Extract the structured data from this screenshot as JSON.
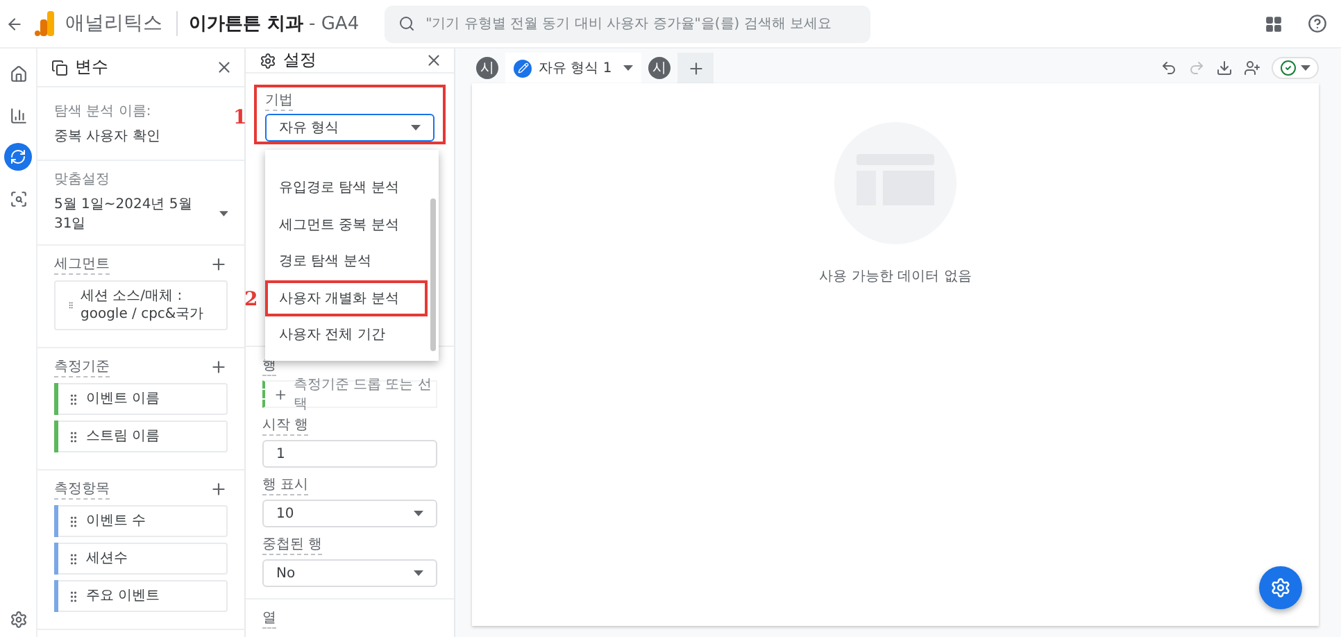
{
  "top_bar": {
    "product": "애널리틱스",
    "property": "이가튼튼 치과",
    "property_suffix": "- GA4",
    "search": {
      "placeholder": "\"기기 유형별 전월 동기 대비 사용자 증가율\"을(를) 검색해 보세요"
    }
  },
  "nav_rail": {
    "items": [
      {
        "kind": "home",
        "selected": false
      },
      {
        "kind": "reports",
        "selected": false
      },
      {
        "kind": "explore",
        "selected": true
      },
      {
        "kind": "advertising",
        "selected": false
      }
    ]
  },
  "variables_panel": {
    "title": "변수",
    "name_label": "탐색 분석 이름:",
    "name": "중복 사용자 확인",
    "date_label": "맞춤설정",
    "date_range": "5월 1일~2024년 5월 31일",
    "sections": [
      {
        "title": "세그먼트",
        "items": [
          {
            "label": "세션 소스/매체 : google / cpc&국가"
          }
        ]
      },
      {
        "title": "측정기준",
        "items": [
          {
            "label": "이벤트 이름",
            "color": "#5cb85c"
          },
          {
            "label": "스트림 이름",
            "color": "#5cb85c"
          }
        ]
      },
      {
        "title": "측정항목",
        "items": [
          {
            "label": "이벤트 수",
            "color": "#7ba7e6"
          },
          {
            "label": "세션수",
            "color": "#7ba7e6"
          },
          {
            "label": "주요 이벤트",
            "color": "#7ba7e6"
          }
        ]
      }
    ]
  },
  "settings_panel": {
    "title": "설정",
    "technique": {
      "label": "기법",
      "value": "자유 형식",
      "annotation": "1"
    },
    "technique_menu": {
      "items": [
        {
          "label": "유입경로 탐색 분석"
        },
        {
          "label": "세그먼트 중복 분석"
        },
        {
          "label": "경로 탐색 분석"
        },
        {
          "label": "사용자 개별화 분석",
          "annotation": "2"
        },
        {
          "label": "사용자 전체 기간"
        }
      ]
    },
    "rows_label": "행",
    "rows_drop": "측정기준 드롭 또는 선택",
    "start_row": {
      "label": "시작 행",
      "value": "1"
    },
    "show_rows": {
      "label": "행 표시",
      "value": "10"
    },
    "nested_rows": {
      "label": "중첩된 행",
      "value": "No"
    },
    "columns_label": "열"
  },
  "tabs": [
    {
      "kind": "avatar",
      "label": "시"
    },
    {
      "kind": "tab",
      "label": "자유 형식 1",
      "selected": true
    },
    {
      "kind": "avatar",
      "label": "시"
    },
    {
      "kind": "add"
    }
  ],
  "canvas": {
    "empty_message": "사용 가능한 데이터 없음"
  }
}
